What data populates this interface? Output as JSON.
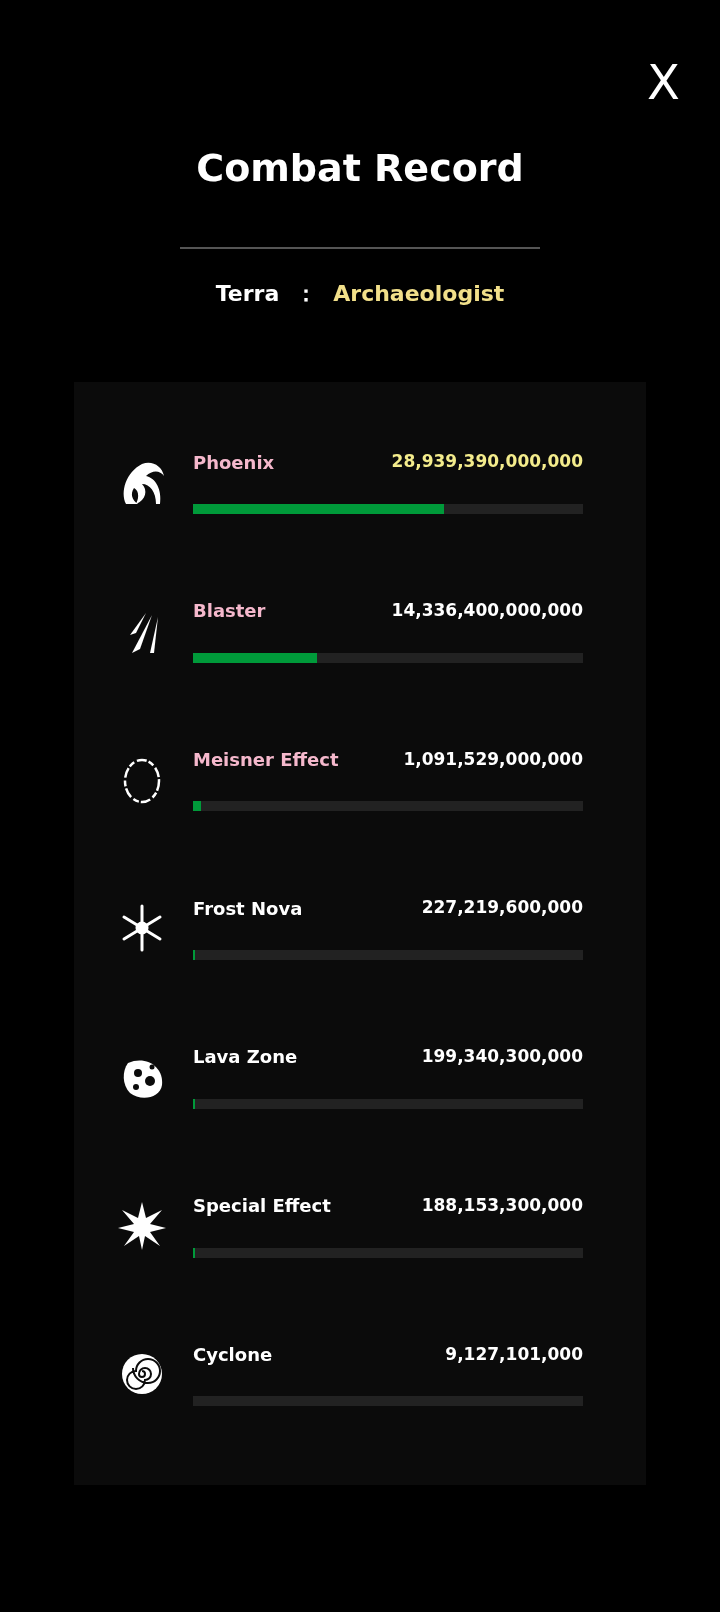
{
  "close_button": {
    "label": "X"
  },
  "title": "Combat Record",
  "subtitle": {
    "label": "Terra",
    "separator": "：",
    "value": "Archaeologist"
  },
  "skills": [
    {
      "kind": "wave",
      "name": "Phoenix",
      "color": "#f5b8cc",
      "value": "28,939,390,000,000",
      "top": true,
      "level": 0.644
    },
    {
      "kind": "claw",
      "name": "Blaster",
      "color": "#f5b8cc",
      "value": "14,336,400,000,000",
      "top": false,
      "level": 0.317
    },
    {
      "kind": "ring",
      "name": "Meisner Effect",
      "color": "#f5b8cc",
      "value": "1,091,529,000,000",
      "top": false,
      "level": 0.021
    },
    {
      "kind": "snowflake",
      "name": "Frost Nova",
      "color": "#ffffff",
      "value": "227,219,600,000",
      "top": false,
      "level": 0.005
    },
    {
      "kind": "rock",
      "name": "Lava Zone",
      "color": "#ffffff",
      "value": "199,340,300,000",
      "top": false,
      "level": 0.005
    },
    {
      "kind": "burst",
      "name": "Special Effect",
      "color": "#ffffff",
      "value": "188,153,300,000",
      "top": false,
      "level": 0.005
    },
    {
      "kind": "spiral",
      "name": "Cyclone",
      "color": "#ffffff",
      "value": "9,127,101,000",
      "top": false
    }
  ]
}
